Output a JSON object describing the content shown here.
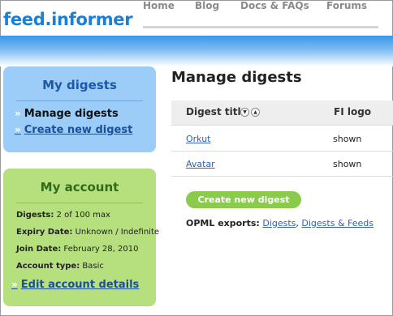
{
  "header": {
    "logo": "feed.informer",
    "nav": [
      "Home",
      "Blog",
      "Docs & FAQs",
      "Forums"
    ]
  },
  "sidebar": {
    "digests_title": "My digests",
    "digest_items": [
      {
        "label": "Manage digests"
      },
      {
        "label": "Create new digest"
      }
    ],
    "account_title": "My account",
    "account_rows": [
      {
        "label": "Digests:",
        "value": "2 of 100 max"
      },
      {
        "label": "Expiry Date:",
        "value": "Unknown / Indefinite"
      },
      {
        "label": "Join Date:",
        "value": "February 28, 2010"
      },
      {
        "label": "Account type:",
        "value": "Basic"
      }
    ],
    "edit_account_label": "Edit account details",
    "arrow_glyph": "»"
  },
  "main": {
    "title": "Manage digests",
    "columns": {
      "digest_title": "Digest title",
      "fi_logo": "FI logo"
    },
    "rows": [
      {
        "name": "Orkut",
        "logo": "shown"
      },
      {
        "name": "Avatar",
        "logo": "shown"
      }
    ],
    "create_button": "Create new digest",
    "opml_label": "OPML exports:",
    "opml_links": [
      "Digests",
      "Digests & Feeds"
    ],
    "opml_sep": ","
  },
  "colors": {
    "brand_blue": "#1a7fd6",
    "digests_panel": "#9ccdf9",
    "account_panel": "#b6df7e",
    "button_green": "#8bcb4c"
  }
}
